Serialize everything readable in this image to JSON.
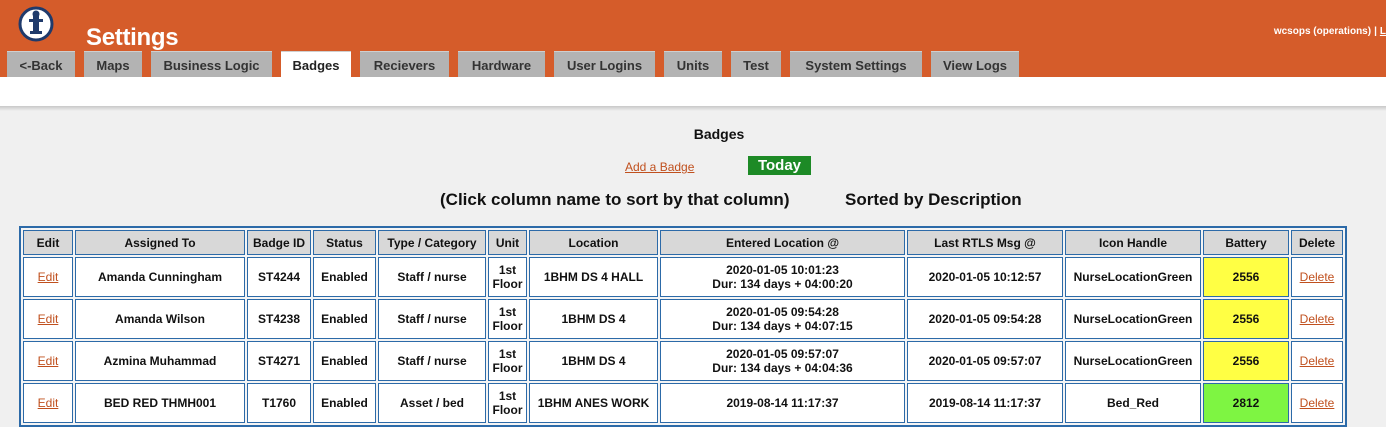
{
  "header": {
    "title": "Settings",
    "user": "wcsops (operations)",
    "separator": "|",
    "logout": "L"
  },
  "tabs": [
    "<-Back",
    "Maps",
    "Business Logic",
    "Badges",
    "Recievers",
    "Hardware",
    "User Logins",
    "Units",
    "Test",
    "System Settings",
    "View Logs"
  ],
  "active_tab": "Badges",
  "main": {
    "section_title": "Badges",
    "add_link": "Add a Badge",
    "today_label": "Today",
    "sort_hint": "(Click column name to sort by that column)",
    "sorted_by": "Sorted by Description"
  },
  "table": {
    "columns": [
      "Edit",
      "Assigned To",
      "Badge ID",
      "Status",
      "Type / Category",
      "Unit",
      "Location",
      "Entered Location @",
      "Last RTLS Msg @",
      "Icon Handle",
      "Battery",
      "Delete"
    ],
    "rows": [
      {
        "edit": "Edit",
        "assigned_to": "Amanda Cunningham",
        "badge_id": "ST4244",
        "status": "Enabled",
        "type": "Staff / nurse",
        "unit_1": "1st",
        "unit_2": "Floor",
        "location_1": "1BHM DS 4 HALL",
        "location_2": "",
        "entered_1": "2020-01-05 10:01:23",
        "entered_2": "Dur: 134 days + 04:00:20",
        "last_rtls": "2020-01-05 10:12:57",
        "icon_handle": "NurseLocationGreen",
        "battery": "2556",
        "battery_color": "#ffff44",
        "delete": "Delete"
      },
      {
        "edit": "Edit",
        "assigned_to": "Amanda Wilson",
        "badge_id": "ST4238",
        "status": "Enabled",
        "type": "Staff / nurse",
        "unit_1": "1st",
        "unit_2": "Floor",
        "location_1": "1BHM DS 4",
        "location_2": "",
        "entered_1": "2020-01-05 09:54:28",
        "entered_2": "Dur: 134 days + 04:07:15",
        "last_rtls": "2020-01-05 09:54:28",
        "icon_handle": "NurseLocationGreen",
        "battery": "2556",
        "battery_color": "#ffff44",
        "delete": "Delete"
      },
      {
        "edit": "Edit",
        "assigned_to": "Azmina Muhammad",
        "badge_id": "ST4271",
        "status": "Enabled",
        "type": "Staff / nurse",
        "unit_1": "1st",
        "unit_2": "Floor",
        "location_1": "1BHM DS 4",
        "location_2": "",
        "entered_1": "2020-01-05 09:57:07",
        "entered_2": "Dur: 134 days + 04:04:36",
        "last_rtls": "2020-01-05 09:57:07",
        "icon_handle": "NurseLocationGreen",
        "battery": "2556",
        "battery_color": "#ffff44",
        "delete": "Delete"
      },
      {
        "edit": "Edit",
        "assigned_to": "BED RED THMH001",
        "badge_id": "T1760",
        "status": "Enabled",
        "type": "Asset / bed",
        "unit_1": "1st",
        "unit_2": "Floor",
        "location_1": "1BHM ANES WORK",
        "location_2": "",
        "entered_1": "2019-08-14 11:17:37",
        "entered_2": "",
        "last_rtls": "2019-08-14 11:17:37",
        "icon_handle": "Bed_Red",
        "battery": "2812",
        "battery_color": "#7ef542",
        "delete": "Delete"
      }
    ]
  }
}
